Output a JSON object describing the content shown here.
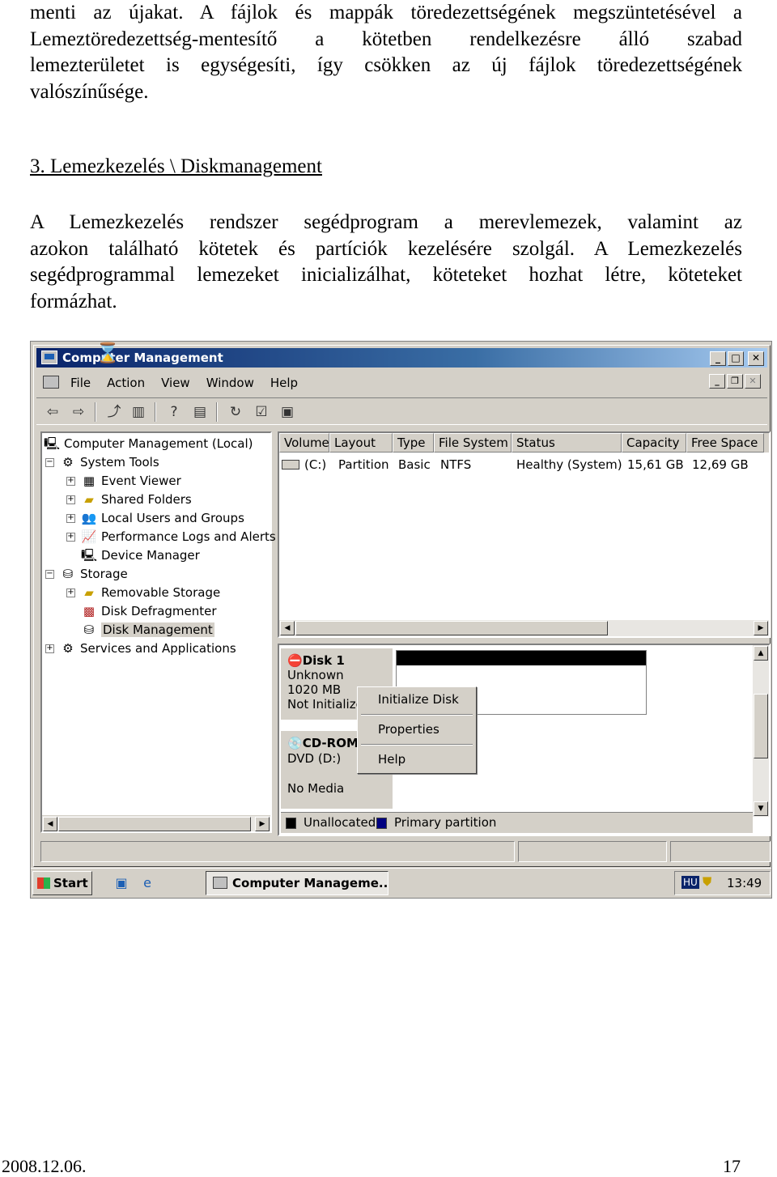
{
  "doc": {
    "intro_lines": [
      "menti az újakat. A fájlok és mappák töredezettségének megszüntetésével a",
      "Lemeztöredezettség-mentesítő a kötetben rendelkezésre álló szabad",
      "lemezterületet is egységesíti, így csökken az új fájlok töredezettségének",
      "valószínűsége."
    ],
    "heading": "3. Lemezkezelés \\ Diskmanagement",
    "body_lines": [
      "A Lemezkezelés rendszer segédprogram a merevlemezek, valamint az",
      "azokon található kötetek és partíciók kezelésére szolgál. A Lemezkezelés",
      "segédprogrammal lemezeket inicializálhat, köteteket hozhat létre, köteteket",
      "formázhat."
    ],
    "footer_date": "2008.12.06.",
    "footer_page": "17"
  },
  "window": {
    "title": "Computer Management",
    "buttons": [
      "_",
      "□",
      "✕"
    ]
  },
  "menu": [
    "File",
    "Action",
    "View",
    "Window",
    "Help"
  ],
  "tree": {
    "root": "Computer Management (Local)",
    "system_tools": "System Tools",
    "event_viewer": "Event Viewer",
    "shared_folders": "Shared Folders",
    "local_users": "Local Users and Groups",
    "perf_logs": "Performance Logs and Alerts",
    "device_manager": "Device Manager",
    "storage": "Storage",
    "removable": "Removable Storage",
    "defrag": "Disk Defragmenter",
    "disk_mgmt": "Disk Management",
    "services": "Services and Applications"
  },
  "volume_list": {
    "columns": [
      "Volume",
      "Layout",
      "Type",
      "File System",
      "Status",
      "Capacity",
      "Free Space"
    ],
    "rows": [
      [
        "(C:)",
        "Partition",
        "Basic",
        "NTFS",
        "Healthy (System)",
        "15,61 GB",
        "12,69 GB"
      ]
    ]
  },
  "disks": {
    "disk1_name": "Disk 1",
    "disk1_type": "Unknown",
    "disk1_size": "1020 MB",
    "disk1_status": "Not Initialize",
    "cd_name": "CD-ROM",
    "cd_drive": "DVD (D:)",
    "cd_media": "No Media"
  },
  "context_menu": [
    "Initialize Disk",
    "Properties",
    "Help"
  ],
  "legend": {
    "unallocated": "Unallocated",
    "primary": "Primary partition"
  },
  "colors": {
    "unallocated": "#000000",
    "primary": "#000080",
    "titlebar": "#0a246a"
  },
  "taskbar": {
    "start": "Start",
    "task": "Computer Manageme...",
    "lang": "HU",
    "clock": "13:49"
  }
}
